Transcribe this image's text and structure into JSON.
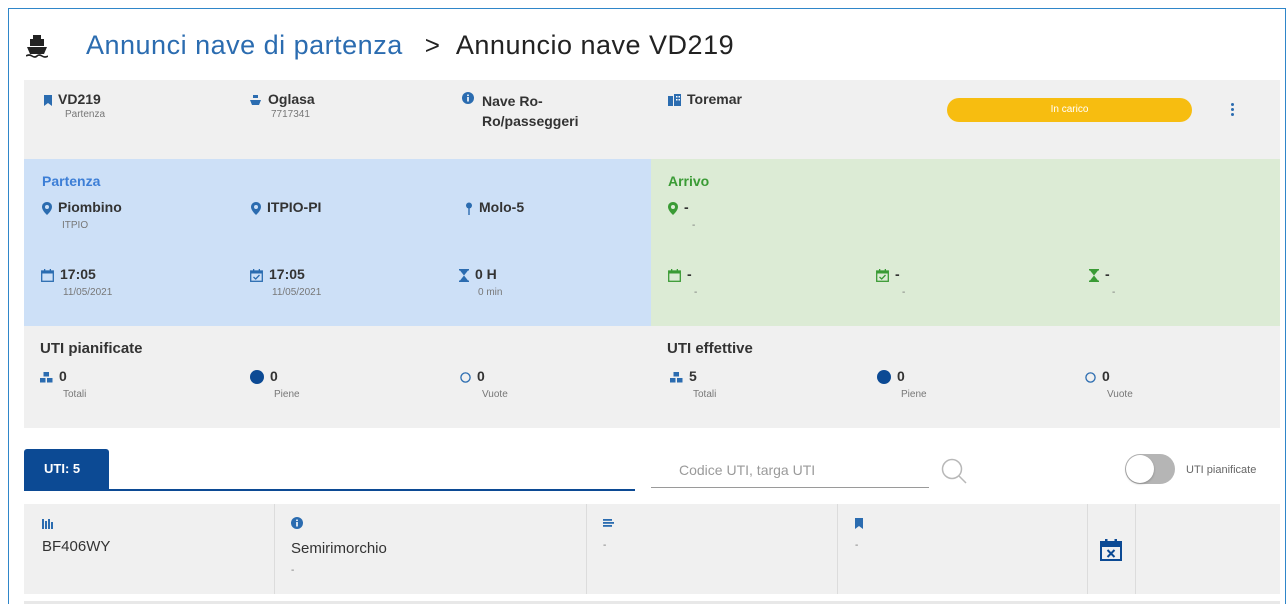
{
  "breadcrumb": {
    "parent": "Annunci nave di partenza",
    "separator": ">",
    "current": "Annuncio nave VD219"
  },
  "ship_info": {
    "code": "VD219",
    "code_sub": "Partenza",
    "name": "Oglasa",
    "name_sub": "7717341",
    "type": "Nave Ro-Ro/passeggeri",
    "company": "Toremar",
    "status": "In carico"
  },
  "departure": {
    "title": "Partenza",
    "city": "Piombino",
    "city_code": "ITPIO",
    "port": "ITPIO-PI",
    "berth": "Molo-5",
    "time_planned": "17:05",
    "date_planned": "11/05/2021",
    "time_actual": "17:05",
    "date_actual": "11/05/2021",
    "duration": "0 H",
    "duration_sub": "0 min"
  },
  "arrival": {
    "title": "Arrivo",
    "place": "-",
    "place_sub": "-",
    "time_planned": "-",
    "time_planned_sub": "-",
    "time_actual": "-",
    "time_actual_sub": "-",
    "duration": "-",
    "duration_sub": "-"
  },
  "uti_planned": {
    "title": "UTI pianificate",
    "total": "0",
    "total_label": "Totali",
    "full": "0",
    "full_label": "Piene",
    "empty": "0",
    "empty_label": "Vuote"
  },
  "uti_actual": {
    "title": "UTI effettive",
    "total": "5",
    "total_label": "Totali",
    "full": "0",
    "full_label": "Piene",
    "empty": "0",
    "empty_label": "Vuote"
  },
  "tabs": [
    {
      "label": "UTI: 5",
      "active": true
    }
  ],
  "search": {
    "placeholder": "Codice UTI, targa UTI",
    "value": ""
  },
  "toggle": {
    "label": "UTI pianificate",
    "on": false
  },
  "table": {
    "rows": [
      {
        "plate": "BF406WY",
        "type": "Semirimorchio",
        "type_sub": "-",
        "col3": "-",
        "col4": "-"
      }
    ]
  },
  "colors": {
    "accent": "#2b6cb0",
    "tab_active": "#0c4a94",
    "status": "#f7bd10",
    "departure_bg": "#cde0f7",
    "arrival_bg": "#dcebd5",
    "arrival_accent": "#3a9b35"
  },
  "icons": {
    "header": "ship-icon",
    "code": "bookmark-icon",
    "name": "ship-icon",
    "type": "info-icon",
    "company": "buildings-icon",
    "place": "location-pin-icon",
    "berth": "pin-icon",
    "date": "calendar-icon",
    "date_check": "calendar-check-icon",
    "duration": "hourglass-icon",
    "total": "boxes-icon",
    "full": "filled-circle-icon",
    "empty": "empty-circle-icon",
    "search": "search-icon",
    "row_delete": "calendar-x-icon"
  }
}
